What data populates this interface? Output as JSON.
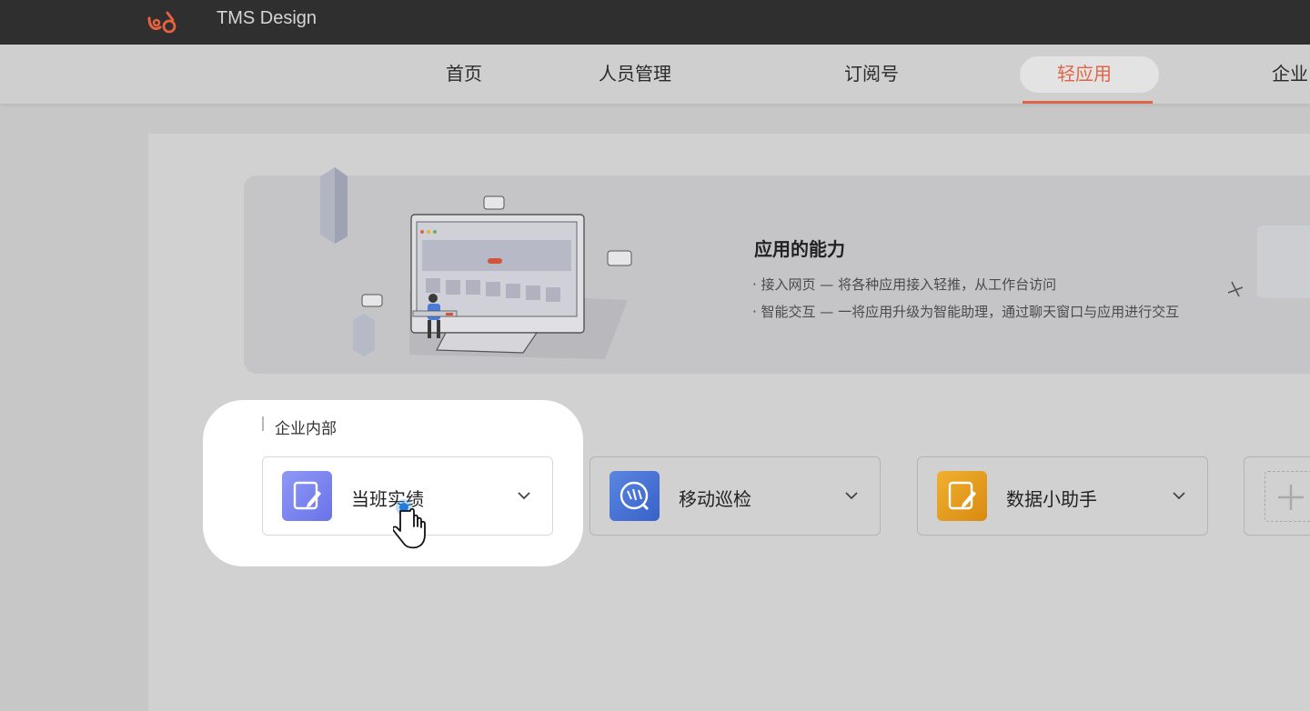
{
  "header": {
    "app_title": "TMS Design"
  },
  "nav": {
    "items": [
      "首页",
      "人员管理",
      "订阅号",
      "轻应用",
      "企业"
    ],
    "active": "轻应用"
  },
  "banner": {
    "title": "应用的能力",
    "lines": [
      "· 接入网页 — 将各种应用接入轻推，从工作台访问",
      "· 智能交互 — 一将应用升级为智能助理，通过聊天窗口与应用进行交互"
    ]
  },
  "section": {
    "label": "企业内部"
  },
  "apps": [
    {
      "name": "当班实绩",
      "icon": "edit-note-icon",
      "color": "#7b86f0"
    },
    {
      "name": "移动巡检",
      "icon": "patrol-icon",
      "color": "#3d6fd6"
    },
    {
      "name": "数据小助手",
      "icon": "edit-note-icon",
      "color": "#e8a020"
    }
  ],
  "colors": {
    "accent": "#e06548",
    "topbar": "#2f2f2f"
  }
}
